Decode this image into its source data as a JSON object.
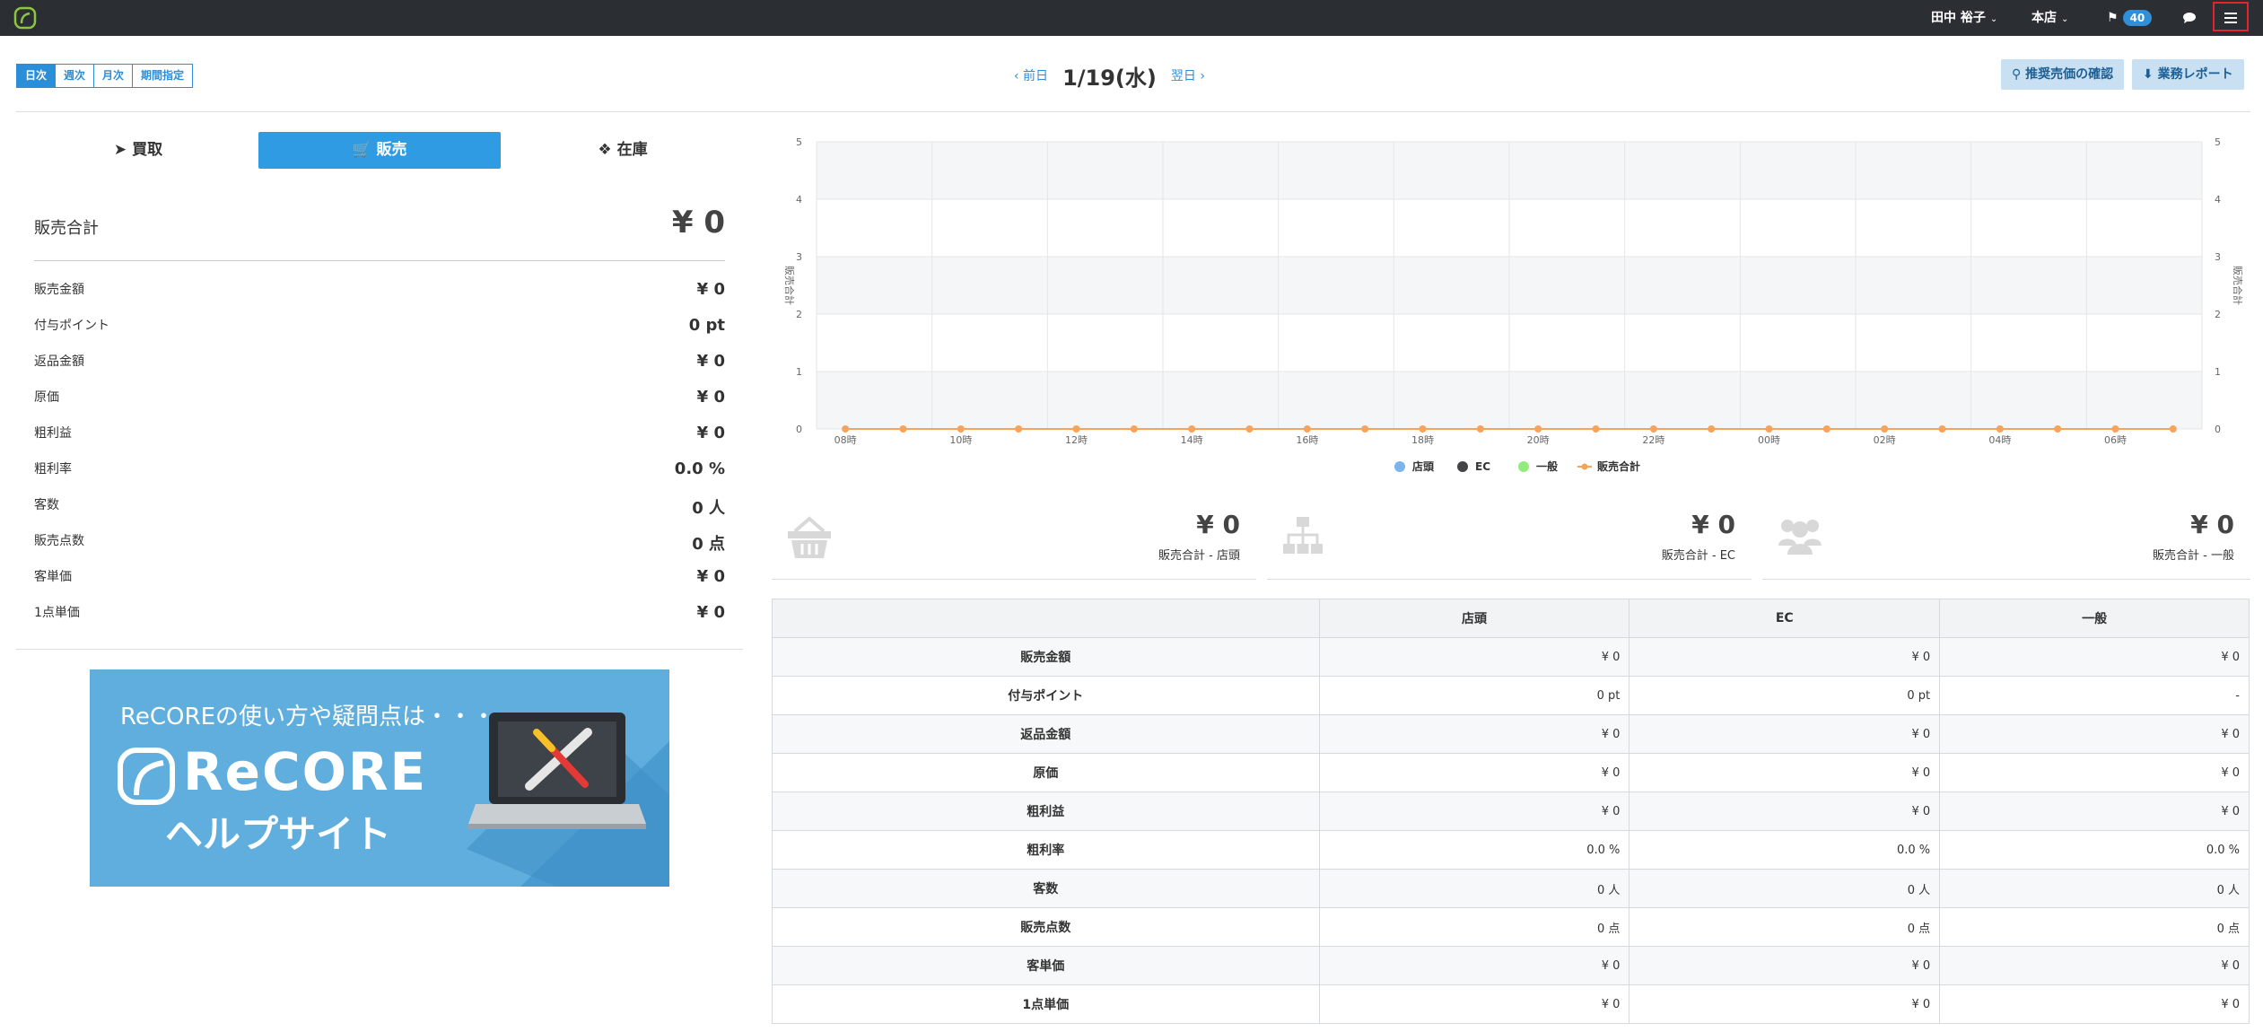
{
  "topbar": {
    "user": "田中 裕子",
    "store": "本店",
    "notification_count": "40"
  },
  "period": {
    "buttons": [
      "日次",
      "週次",
      "月次",
      "期間指定"
    ],
    "active": "日次"
  },
  "datenav": {
    "prev": "‹ 前日",
    "date": "1/19(水)",
    "next": "翌日 ›"
  },
  "actions": {
    "recommend": "推奨売価の確認",
    "report": "業務レポート"
  },
  "tabs": {
    "buy": "買取",
    "sell": "販売",
    "stock": "在庫"
  },
  "summary": {
    "total_label": "販売合計",
    "total_value": "¥ 0",
    "metrics": [
      {
        "label": "販売金額",
        "value": "¥ 0"
      },
      {
        "label": "付与ポイント",
        "value": "0 pt"
      },
      {
        "label": "返品金額",
        "value": "¥ 0"
      },
      {
        "label": "原価",
        "value": "¥ 0"
      },
      {
        "label": "粗利益",
        "value": "¥ 0"
      },
      {
        "label": "粗利率",
        "value": "0.0 %"
      },
      {
        "label": "客数",
        "value": "0 人"
      },
      {
        "label": "販売点数",
        "value": "0 点"
      },
      {
        "label": "客単価",
        "value": "¥ 0"
      },
      {
        "label": "1点単価",
        "value": "¥ 0"
      }
    ]
  },
  "banner": {
    "line1": "ReCOREの使い方や疑問点は・・・",
    "brand": "ReCORE",
    "line2": "ヘルプサイト"
  },
  "colors": {
    "accent": "#2f9be3",
    "store": "#7cb5ec",
    "ec": "#434348",
    "general": "#90ed7d",
    "total": "#f7a35c"
  },
  "chart_data": {
    "type": "line",
    "x": [
      "08時",
      "09時",
      "10時",
      "11時",
      "12時",
      "13時",
      "14時",
      "15時",
      "16時",
      "17時",
      "18時",
      "19時",
      "20時",
      "21時",
      "22時",
      "23時",
      "00時",
      "01時",
      "02時",
      "03時",
      "04時",
      "05時",
      "06時",
      "07時"
    ],
    "x_tick_labels": [
      "08時",
      "10時",
      "12時",
      "14時",
      "16時",
      "18時",
      "20時",
      "22時",
      "00時",
      "02時",
      "04時",
      "06時"
    ],
    "series": [
      {
        "name": "店頭",
        "values": [
          0,
          0,
          0,
          0,
          0,
          0,
          0,
          0,
          0,
          0,
          0,
          0,
          0,
          0,
          0,
          0,
          0,
          0,
          0,
          0,
          0,
          0,
          0,
          0
        ]
      },
      {
        "name": "EC",
        "values": [
          0,
          0,
          0,
          0,
          0,
          0,
          0,
          0,
          0,
          0,
          0,
          0,
          0,
          0,
          0,
          0,
          0,
          0,
          0,
          0,
          0,
          0,
          0,
          0
        ]
      },
      {
        "name": "一般",
        "values": [
          0,
          0,
          0,
          0,
          0,
          0,
          0,
          0,
          0,
          0,
          0,
          0,
          0,
          0,
          0,
          0,
          0,
          0,
          0,
          0,
          0,
          0,
          0,
          0
        ]
      },
      {
        "name": "販売合計",
        "values": [
          0,
          0,
          0,
          0,
          0,
          0,
          0,
          0,
          0,
          0,
          0,
          0,
          0,
          0,
          0,
          0,
          0,
          0,
          0,
          0,
          0,
          0,
          0,
          0
        ]
      }
    ],
    "ylabel": "販売合計",
    "y2label": "販売合計",
    "ylim": [
      0,
      5
    ],
    "y_ticks": [
      "0",
      "1",
      "2",
      "3",
      "4",
      "5"
    ],
    "legend": [
      "店頭",
      "EC",
      "一般",
      "販売合計"
    ],
    "legend_position": "bottom",
    "grid": true
  },
  "cards": [
    {
      "value": "¥ 0",
      "label": "販売合計 - 店頭"
    },
    {
      "value": "¥ 0",
      "label": "販売合計 - EC"
    },
    {
      "value": "¥ 0",
      "label": "販売合計 - 一般"
    }
  ],
  "table": {
    "columns": [
      "",
      "店頭",
      "EC",
      "一般"
    ],
    "rows": [
      {
        "label": "販売金額",
        "cells": [
          "¥ 0",
          "¥ 0",
          "¥ 0"
        ]
      },
      {
        "label": "付与ポイント",
        "cells": [
          "0 pt",
          "0 pt",
          "-"
        ]
      },
      {
        "label": "返品金額",
        "cells": [
          "¥ 0",
          "¥ 0",
          "¥ 0"
        ]
      },
      {
        "label": "原価",
        "cells": [
          "¥ 0",
          "¥ 0",
          "¥ 0"
        ]
      },
      {
        "label": "粗利益",
        "cells": [
          "¥ 0",
          "¥ 0",
          "¥ 0"
        ]
      },
      {
        "label": "粗利率",
        "cells": [
          "0.0 %",
          "0.0 %",
          "0.0 %"
        ]
      },
      {
        "label": "客数",
        "cells": [
          "0 人",
          "0 人",
          "0 人"
        ]
      },
      {
        "label": "販売点数",
        "cells": [
          "0 点",
          "0 点",
          "0 点"
        ]
      },
      {
        "label": "客単価",
        "cells": [
          "¥ 0",
          "¥ 0",
          "¥ 0"
        ]
      },
      {
        "label": "1点単価",
        "cells": [
          "¥ 0",
          "¥ 0",
          "¥ 0"
        ]
      }
    ]
  }
}
